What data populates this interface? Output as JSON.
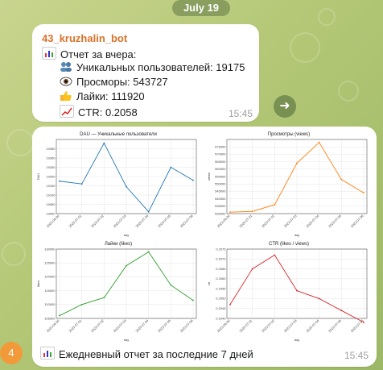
{
  "date_label": "July 19",
  "message1": {
    "sender": "43_kruzhalin_bot",
    "lines": [
      "Отчет за вчера:",
      "Уникальных пользователей: 19175",
      "Просморы: 543727",
      "Лайки: 111920",
      "CTR: 0.2058"
    ],
    "time": "15:45"
  },
  "message2": {
    "caption": "Ежедневный отчет за последние 7 дней",
    "time": "15:45"
  },
  "unread_count": "4",
  "icons": [
    "chart-emoji-icon",
    "users-emoji-icon",
    "eye-emoji-icon",
    "thumbs-up-emoji-icon",
    "trend-emoji-icon",
    "forward-icon"
  ],
  "chart_data": [
    {
      "type": "line",
      "title": "DAU — Уникальные пользователи",
      "xlabel": "day",
      "ylabel": "DAU",
      "color": "#1f77b4",
      "categories": [
        "2023-06-30",
        "2023-07-01",
        "2023-07-02",
        "2023-07-03",
        "2023-07-04",
        "2023-07-05",
        "2023-07-06"
      ],
      "values": [
        19175,
        19160,
        19380,
        19145,
        19010,
        19250,
        19180
      ],
      "ylim": [
        19000,
        19400
      ],
      "yticks": [
        "19000",
        "19050",
        "19100",
        "19150",
        "19200",
        "19250",
        "19300",
        "19350"
      ]
    },
    {
      "type": "line",
      "title": "Просмотры (views)",
      "xlabel": "day",
      "ylabel": "views",
      "color": "#ff7f0e",
      "categories": [
        "2023-06-30",
        "2023-07-01",
        "2023-07-02",
        "2023-07-03",
        "2023-07-04",
        "2023-07-05",
        "2023-07-06"
      ],
      "values": [
        531000,
        531500,
        536000,
        564000,
        578000,
        553000,
        544000
      ],
      "ylim": [
        530000,
        580000
      ],
      "yticks": [
        "530000",
        "535000",
        "540000",
        "545000",
        "550000",
        "555000",
        "560000",
        "565000",
        "570000",
        "575000"
      ]
    },
    {
      "type": "line",
      "title": "Лайки (likes)",
      "xlabel": "day",
      "ylabel": "likes",
      "color": "#2ca02c",
      "categories": [
        "2023-06-30",
        "2023-07-01",
        "2023-07-02",
        "2023-07-03",
        "2023-07-04",
        "2023-07-05",
        "2023-07-06"
      ],
      "values": [
        106000,
        110000,
        112500,
        124000,
        129000,
        117000,
        111500
      ],
      "ylim": [
        105000,
        130000
      ],
      "yticks": [
        "105000",
        "110000",
        "115000",
        "120000",
        "125000",
        "130000"
      ]
    },
    {
      "type": "line",
      "title": "CTR (likes / views)",
      "xlabel": "day",
      "ylabel": "ctr",
      "color": "#d62728",
      "categories": [
        "2023-06-30",
        "2023-07-01",
        "2023-07-02",
        "2023-07-03",
        "2023-07-04",
        "2023-07-05",
        "2023-07-06"
      ],
      "values": [
        0.2047,
        0.2065,
        0.2072,
        0.2054,
        0.205,
        0.2044,
        0.2038
      ],
      "ylim": [
        0.204,
        0.2075
      ],
      "yticks": [
        "0.2040",
        "0.2045",
        "0.2050",
        "0.2055",
        "0.2060",
        "0.2065",
        "0.2070",
        "0.2075"
      ]
    }
  ]
}
